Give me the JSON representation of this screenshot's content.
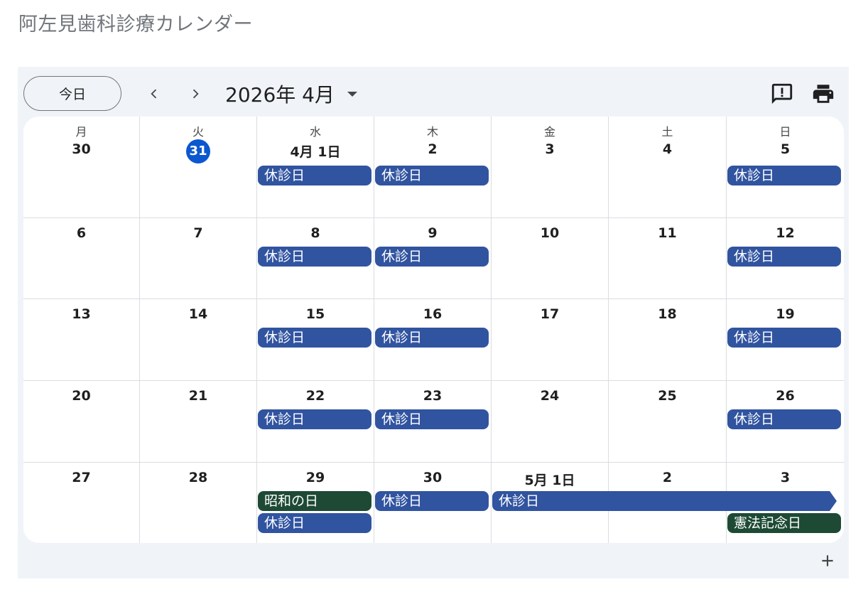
{
  "page": {
    "title": "阿左見歯科診療カレンダー"
  },
  "toolbar": {
    "today_label": "今日",
    "month_label": "2026年 4月"
  },
  "colors": {
    "accent": "#0b57d0",
    "closed": "#3154a0",
    "holiday": "#1e4a35"
  },
  "weekdays": [
    "月",
    "火",
    "水",
    "木",
    "金",
    "土",
    "日"
  ],
  "weeks": [
    [
      "30",
      "31",
      "4月 1日",
      "2",
      "3",
      "4",
      "5"
    ],
    [
      "6",
      "7",
      "8",
      "9",
      "10",
      "11",
      "12"
    ],
    [
      "13",
      "14",
      "15",
      "16",
      "17",
      "18",
      "19"
    ],
    [
      "20",
      "21",
      "22",
      "23",
      "24",
      "25",
      "26"
    ],
    [
      "27",
      "28",
      "29",
      "30",
      "5月 1日",
      "2",
      "3"
    ]
  ],
  "today": {
    "week": 0,
    "day": 1
  },
  "events": [
    {
      "week": 0,
      "day": 2,
      "span": 1,
      "slot": 0,
      "label": "休診日",
      "kind": "closed"
    },
    {
      "week": 0,
      "day": 3,
      "span": 1,
      "slot": 0,
      "label": "休診日",
      "kind": "closed"
    },
    {
      "week": 0,
      "day": 6,
      "span": 1,
      "slot": 0,
      "label": "休診日",
      "kind": "closed"
    },
    {
      "week": 1,
      "day": 2,
      "span": 1,
      "slot": 0,
      "label": "休診日",
      "kind": "closed"
    },
    {
      "week": 1,
      "day": 3,
      "span": 1,
      "slot": 0,
      "label": "休診日",
      "kind": "closed"
    },
    {
      "week": 1,
      "day": 6,
      "span": 1,
      "slot": 0,
      "label": "休診日",
      "kind": "closed"
    },
    {
      "week": 2,
      "day": 2,
      "span": 1,
      "slot": 0,
      "label": "休診日",
      "kind": "closed"
    },
    {
      "week": 2,
      "day": 3,
      "span": 1,
      "slot": 0,
      "label": "休診日",
      "kind": "closed"
    },
    {
      "week": 2,
      "day": 6,
      "span": 1,
      "slot": 0,
      "label": "休診日",
      "kind": "closed"
    },
    {
      "week": 3,
      "day": 2,
      "span": 1,
      "slot": 0,
      "label": "休診日",
      "kind": "closed"
    },
    {
      "week": 3,
      "day": 3,
      "span": 1,
      "slot": 0,
      "label": "休診日",
      "kind": "closed"
    },
    {
      "week": 3,
      "day": 6,
      "span": 1,
      "slot": 0,
      "label": "休診日",
      "kind": "closed"
    },
    {
      "week": 4,
      "day": 2,
      "span": 1,
      "slot": 0,
      "label": "昭和の日",
      "kind": "holiday"
    },
    {
      "week": 4,
      "day": 2,
      "span": 1,
      "slot": 1,
      "label": "休診日",
      "kind": "closed"
    },
    {
      "week": 4,
      "day": 3,
      "span": 1,
      "slot": 0,
      "label": "休診日",
      "kind": "closed"
    },
    {
      "week": 4,
      "day": 4,
      "span": 3,
      "slot": 0,
      "label": "休診日",
      "kind": "closed",
      "continues": true
    },
    {
      "week": 4,
      "day": 6,
      "span": 1,
      "slot": 1,
      "label": "憲法記念日",
      "kind": "holiday"
    }
  ]
}
